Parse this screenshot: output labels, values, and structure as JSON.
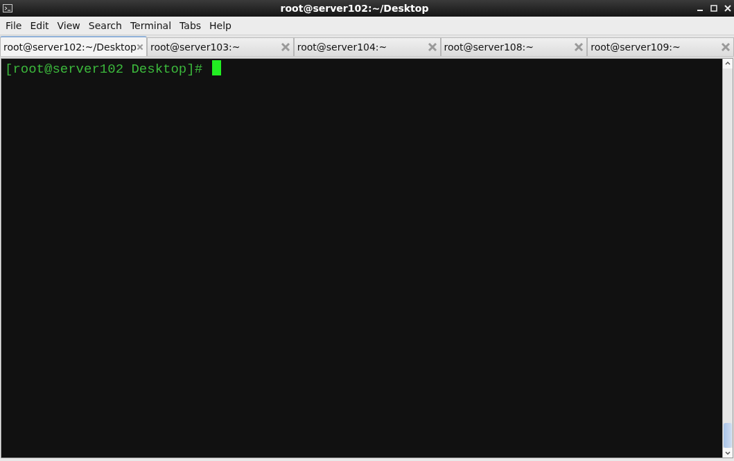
{
  "window": {
    "title": "root@server102:~/Desktop"
  },
  "menu": [
    "File",
    "Edit",
    "View",
    "Search",
    "Terminal",
    "Tabs",
    "Help"
  ],
  "tabs": [
    {
      "label": "root@server102:~/Desktop",
      "selected": true
    },
    {
      "label": "root@server103:~",
      "selected": false
    },
    {
      "label": "root@server104:~",
      "selected": false
    },
    {
      "label": "root@server108:~",
      "selected": false
    },
    {
      "label": "root@server109:~",
      "selected": false
    }
  ],
  "terminal": {
    "prompt": "[root@server102 Desktop]#"
  }
}
